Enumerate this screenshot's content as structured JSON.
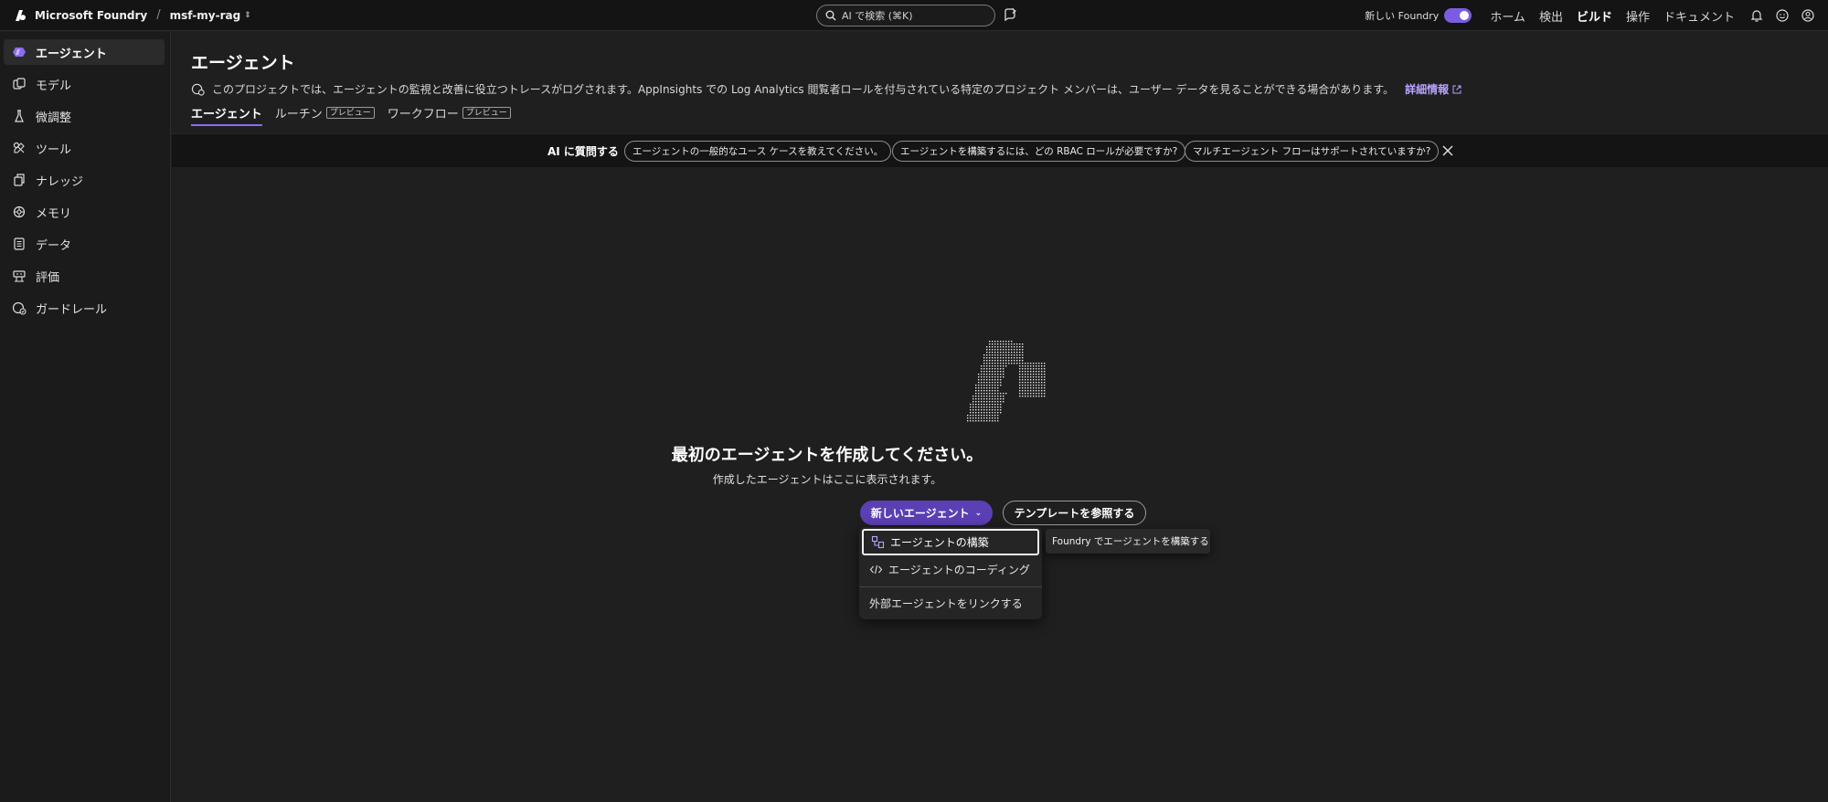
{
  "topbar": {
    "brand": "Microsoft Foundry",
    "separator": "/",
    "project": "msf-my-rag",
    "search_placeholder": "AI で検索 (⌘K)",
    "new_foundry_label": "新しい Foundry",
    "new_foundry_on": true,
    "nav": [
      "ホーム",
      "検出",
      "ビルド",
      "操作",
      "ドキュメント"
    ],
    "active_nav": "ビルド",
    "accent_color": "#7b5ce0"
  },
  "sidebar": {
    "items": [
      {
        "label": "エージェント",
        "icon": "agent-icon",
        "active": true
      },
      {
        "label": "モデル",
        "icon": "model-icon"
      },
      {
        "label": "微調整",
        "icon": "flask-icon"
      },
      {
        "label": "ツール",
        "icon": "tools-icon"
      },
      {
        "label": "ナレッジ",
        "icon": "knowledge-icon"
      },
      {
        "label": "メモリ",
        "icon": "memory-icon"
      },
      {
        "label": "データ",
        "icon": "data-icon"
      },
      {
        "label": "評価",
        "icon": "evaluation-icon"
      },
      {
        "label": "ガードレール",
        "icon": "guardrail-icon"
      }
    ]
  },
  "main": {
    "title": "エージェント",
    "info_text": "このプロジェクトでは、エージェントの監視と改善に役立つトレースがログされます。AppInsights での Log Analytics 閲覧者ロールを付与されている特定のプロジェクト メンバーは、ユーザー データを見ることができる場合があります。",
    "info_link": "詳細情報",
    "tabs": [
      {
        "label": "エージェント",
        "active": true
      },
      {
        "label": "ルーチン",
        "badge": "プレビュー"
      },
      {
        "label": "ワークフロー",
        "badge": "プレビュー"
      }
    ]
  },
  "ask_ai": {
    "label": "AI に質問する",
    "chips": [
      "エージェントの一般的なユース ケースを教えてください。",
      "エージェントを構築するには、どの RBAC ロールが必要ですか?",
      "マルチエージェント フローはサポートされていますか?"
    ]
  },
  "empty_state": {
    "title": "最初のエージェントを作成してください。",
    "subtitle": "作成したエージェントはここに表示されます。",
    "primary_button": "新しいエージェント",
    "secondary_button": "テンプレートを参照する"
  },
  "dropdown": {
    "items": [
      {
        "label": "エージェントの構築",
        "icon": "build-icon",
        "focused": true
      },
      {
        "label": "エージェントのコーディング",
        "icon": "code-icon"
      },
      {
        "label": "外部エージェントをリンクする"
      }
    ],
    "tooltip": "Foundry でエージェントを構築する"
  }
}
